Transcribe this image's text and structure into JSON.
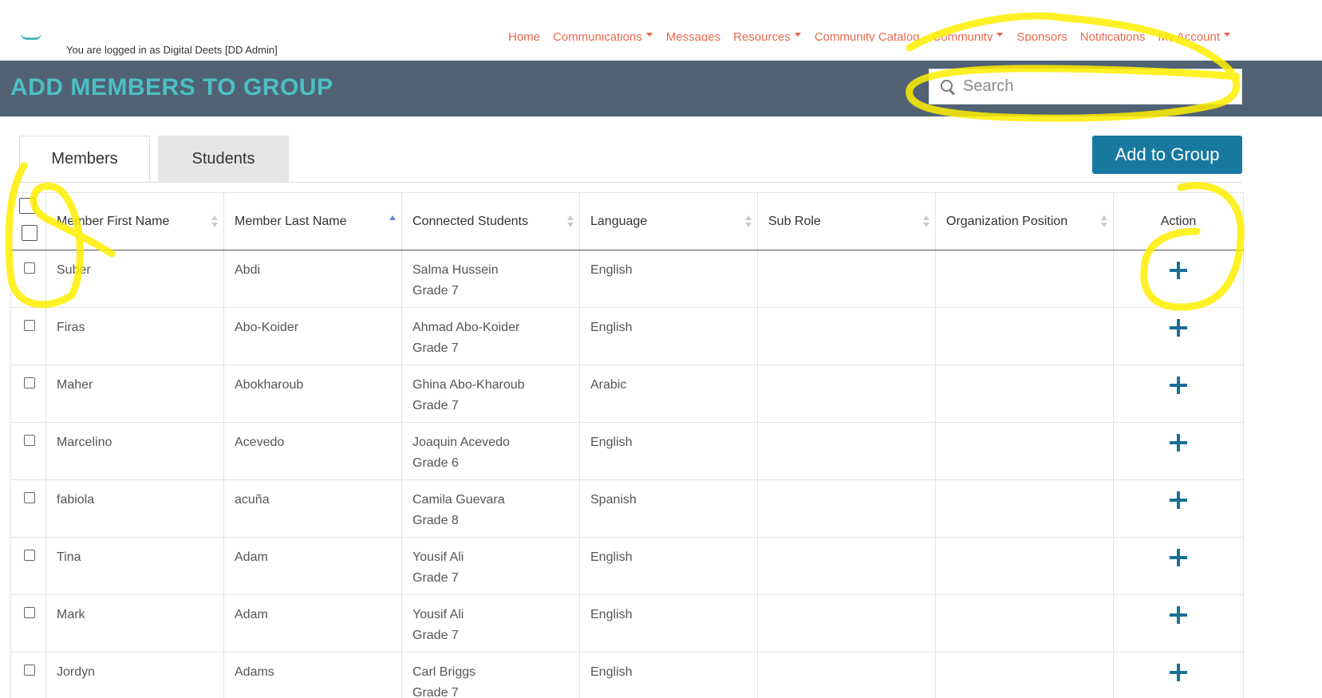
{
  "header": {
    "logged_in_text": "You are logged in as Digital Deets [DD Admin]",
    "nav": [
      {
        "label": "Home",
        "dropdown": false
      },
      {
        "label": "Communications",
        "dropdown": true
      },
      {
        "label": "Messages",
        "dropdown": false
      },
      {
        "label": "Resources",
        "dropdown": true
      },
      {
        "label": "Community Catalog",
        "dropdown": false
      },
      {
        "label": "Community",
        "dropdown": true
      },
      {
        "label": "Sponsors",
        "dropdown": false
      },
      {
        "label": "Notifications",
        "dropdown": false
      },
      {
        "label": "My Account",
        "dropdown": true
      }
    ]
  },
  "page": {
    "title": "ADD MEMBERS TO GROUP",
    "search_placeholder": "Search"
  },
  "tabs": [
    {
      "label": "Members",
      "active": true
    },
    {
      "label": "Students",
      "active": false
    }
  ],
  "add_button_label": "Add to Group",
  "table": {
    "columns": [
      "Member First Name",
      "Member Last Name",
      "Connected Students",
      "Language",
      "Sub Role",
      "Organization Position",
      "Action"
    ],
    "sorted_column": "Member Last Name",
    "rows": [
      {
        "first": "Suber",
        "last": "Abdi",
        "student": "Salma Hussein",
        "grade": "Grade 7",
        "language": "English",
        "sub_role": "",
        "position": ""
      },
      {
        "first": "Firas",
        "last": "Abo-Koider",
        "student": "Ahmad Abo-Koider",
        "grade": "Grade 7",
        "language": "English",
        "sub_role": "",
        "position": ""
      },
      {
        "first": "Maher",
        "last": "Abokharoub",
        "student": "Ghina Abo-Kharoub",
        "grade": "Grade 7",
        "language": "Arabic",
        "sub_role": "",
        "position": ""
      },
      {
        "first": "Marcelino",
        "last": "Acevedo",
        "student": "Joaquin Acevedo",
        "grade": "Grade 6",
        "language": "English",
        "sub_role": "",
        "position": ""
      },
      {
        "first": "fabiola",
        "last": "acuña",
        "student": "Camila Guevara",
        "grade": "Grade 8",
        "language": "Spanish",
        "sub_role": "",
        "position": ""
      },
      {
        "first": "Tina",
        "last": "Adam",
        "student": "Yousif Ali",
        "grade": "Grade 7",
        "language": "English",
        "sub_role": "",
        "position": ""
      },
      {
        "first": "Mark",
        "last": "Adam",
        "student": "Yousif Ali",
        "grade": "Grade 7",
        "language": "English",
        "sub_role": "",
        "position": ""
      },
      {
        "first": "Jordyn",
        "last": "Adams",
        "student": "Carl Briggs",
        "grade": "Grade 7",
        "language": "English",
        "sub_role": "",
        "position": ""
      }
    ]
  },
  "colors": {
    "header_band": "#506274",
    "title": "#4cc0c4",
    "nav": "#e86a4f",
    "button": "#1779a0",
    "plus_icon": "#1a6f94",
    "highlight": "#ffee00"
  }
}
